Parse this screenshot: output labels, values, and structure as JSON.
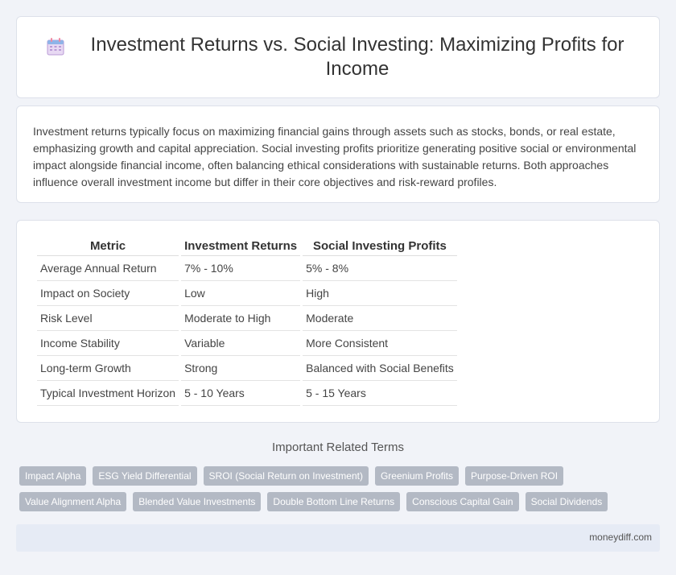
{
  "header": {
    "title": "Investment Returns vs. Social Investing: Maximizing Profits for Income",
    "icon": "calendar-icon"
  },
  "summary": {
    "text": "Investment returns typically focus on maximizing financial gains through assets such as stocks, bonds, or real estate, emphasizing growth and capital appreciation. Social investing profits prioritize generating positive social or environmental impact alongside financial income, often balancing ethical considerations with sustainable returns. Both approaches influence overall investment income but differ in their core objectives and risk-reward profiles."
  },
  "table": {
    "headers": [
      "Metric",
      "Investment Returns",
      "Social Investing Profits"
    ],
    "rows": [
      [
        "Average Annual Return",
        "7% - 10%",
        "5% - 8%"
      ],
      [
        "Impact on Society",
        "Low",
        "High"
      ],
      [
        "Risk Level",
        "Moderate to High",
        "Moderate"
      ],
      [
        "Income Stability",
        "Variable",
        "More Consistent"
      ],
      [
        "Long-term Growth",
        "Strong",
        "Balanced with Social Benefits"
      ],
      [
        "Typical Investment Horizon",
        "5 - 10 Years",
        "5 - 15 Years"
      ]
    ]
  },
  "related": {
    "title": "Important Related Terms",
    "row1": [
      "Impact Alpha",
      "ESG Yield Differential",
      "SROI (Social Return on Investment)",
      "Greenium Profits",
      "Purpose-Driven ROI"
    ],
    "row2": [
      "Value Alignment Alpha",
      "Blended Value Investments",
      "Double Bottom Line Returns",
      "Conscious Capital Gain",
      "Social Dividends"
    ]
  },
  "footer": {
    "site": "moneydiff.com"
  },
  "colors": {
    "tag_bg": "#b3b9c4",
    "page_bg": "#f1f3f8",
    "footer_bg": "#e6ebf5"
  }
}
